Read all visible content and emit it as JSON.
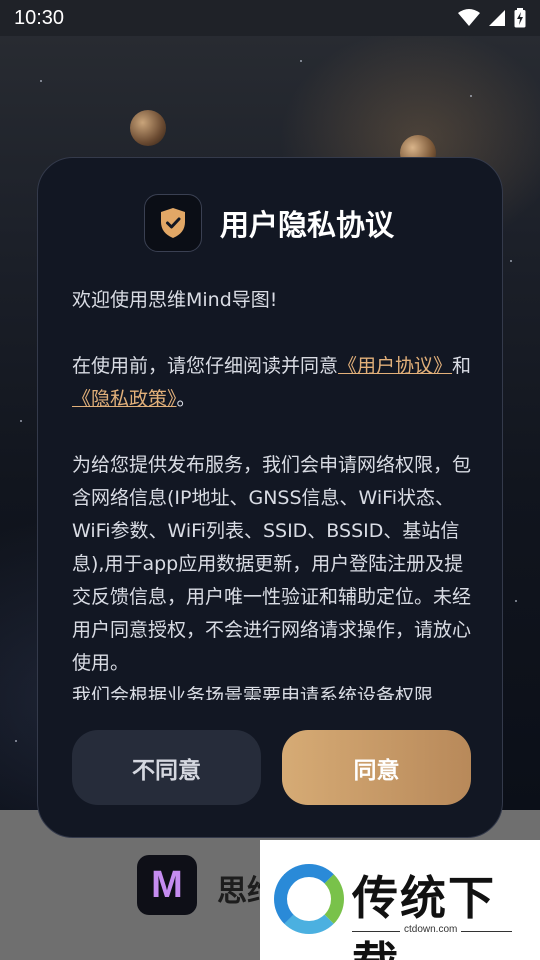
{
  "status_bar": {
    "time": "10:30"
  },
  "dialog": {
    "title": "用户隐私协议",
    "welcome": "欢迎使用思维Mind导图!",
    "consent_prefix": "在使用前，请您仔细阅读并同意",
    "user_agreement_link": "《用户协议》",
    "consent_and": "和",
    "privacy_policy_link": "《隐私政策》",
    "consent_suffix": "。",
    "permission_text": "为给您提供发布服务，我们会申请网络权限，包含网络信息(IP地址、GNSS信息、WiFi状态、WiFi参数、WiFi列表、SSID、BSSID、基站信息),用于app应用数据更新，用户登陆注册及提交反馈信息，用户唯一性验证和辅助定位。未经用户同意授权，不会进行网络请求操作，请放心使用。",
    "more_text": "我们会根据业务场景需要申请系统设备权限",
    "decline_label": "不同意",
    "accept_label": "同意"
  },
  "background_app": {
    "name": "思维",
    "icon": "mind-app-icon"
  },
  "watermark": {
    "text": "传统下载",
    "url": "ctdown.com"
  },
  "colors": {
    "accent": "#d6ab75",
    "link": "#e2b07a",
    "dialog_bg": "#121723",
    "decline_bg": "#262c3a"
  }
}
